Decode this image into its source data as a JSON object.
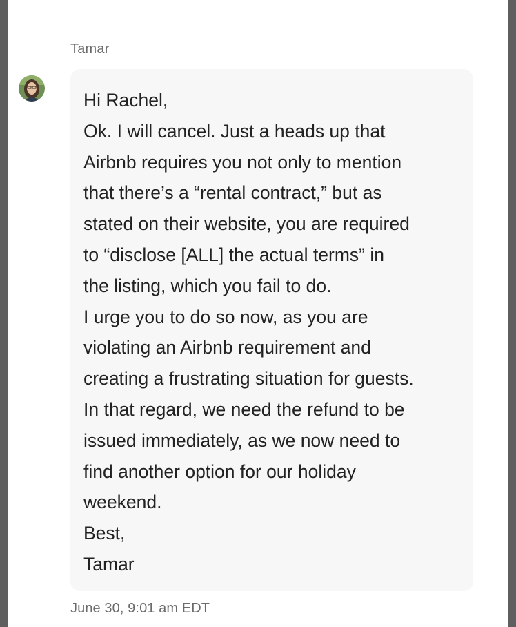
{
  "thread": {
    "sender_name": "Tamar",
    "avatar_icon": "user-photo-icon",
    "message_lines": [
      "Hi Rachel,",
      "Ok. I will cancel. Just a heads up that",
      "Airbnb requires you not only to mention",
      "that there’s a “rental contract,” but as",
      "stated on their website, you are required",
      "to “disclose [ALL] the actual terms” in",
      "the listing, which you fail to do.",
      "I urge you to do so now, as you are",
      "violating an Airbnb requirement and",
      "creating a frustrating situation for guests.",
      "In that regard, we need the refund to be",
      "issued immediately, as we now need to",
      "find another option for our holiday",
      "weekend.",
      "Best,",
      "Tamar"
    ],
    "timestamp": "June 30, 9:01 am EDT"
  },
  "colors": {
    "bubble_bg": "#f7f7f7",
    "text": "#222222",
    "meta_text": "#6b6b6b",
    "frame": "#5f5f5f"
  }
}
